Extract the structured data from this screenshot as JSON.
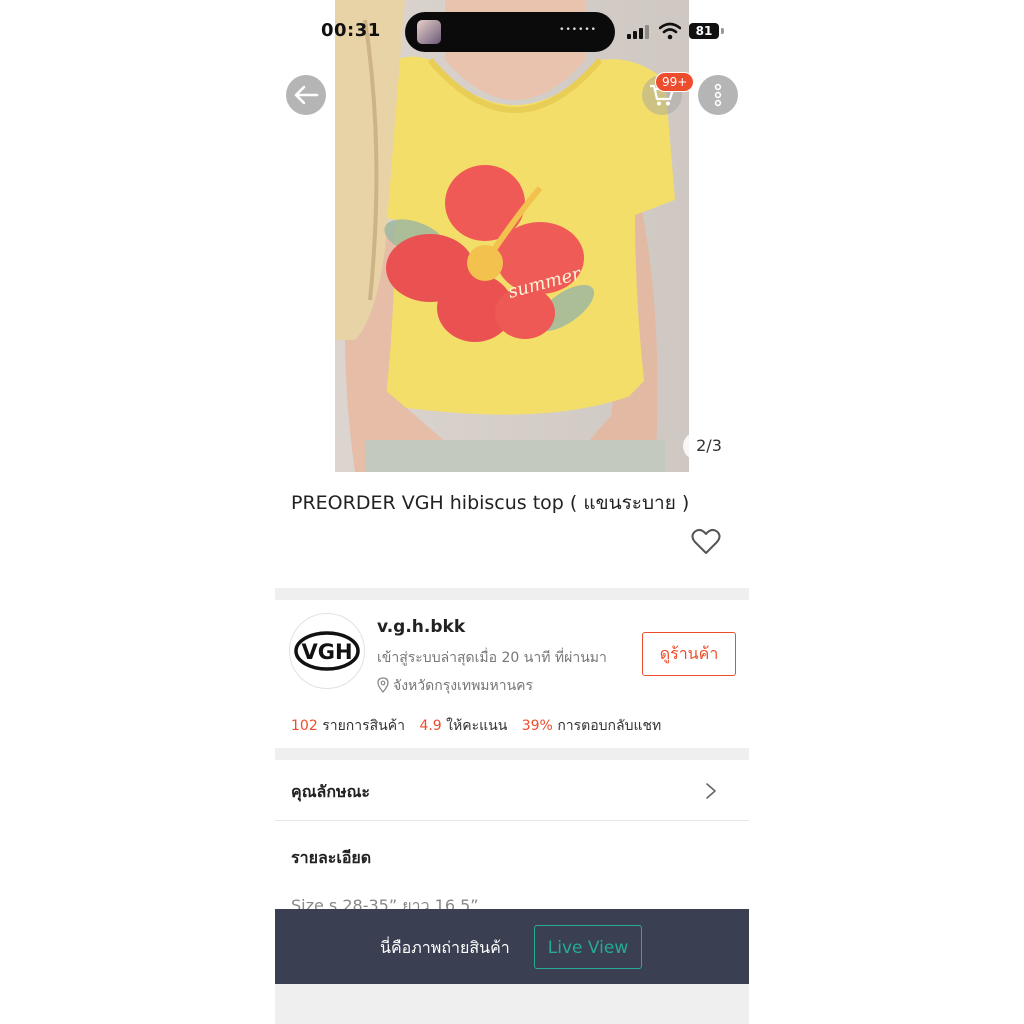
{
  "status_bar": {
    "time": "00:31",
    "battery": "81"
  },
  "header": {
    "cart_badge": "99+"
  },
  "gallery": {
    "page_indicator": "2/3",
    "shirt_print_text": "summer"
  },
  "product": {
    "title": "PREORDER  VGH hibiscus top ( แขนระบาย )"
  },
  "shop": {
    "logo_text": "VGH",
    "name": "v.g.h.bkk",
    "last_active": "เข้าสู่ระบบล่าสุดเมื่อ 20 นาที ที่ผ่านมา",
    "location": "จังหวัดกรุงเทพมหานคร",
    "view_shop_label": "ดูร้านค้า",
    "stats": [
      {
        "value": "102",
        "label": "รายการสินค้า"
      },
      {
        "value": "4.9",
        "label": "ให้คะแนน"
      },
      {
        "value": "39%",
        "label": "การตอบกลับแชท"
      }
    ]
  },
  "attributes": {
    "label": "คุณลักษณะ"
  },
  "details": {
    "title": "รายละเอียด",
    "text": "Size s 28-35” ยาว 16.5”"
  },
  "bottom_bar": {
    "text": "นี่คือภาพถ่ายสินค้า",
    "live_view_label": "Live View"
  },
  "colors": {
    "accent": "#ee4d2d",
    "live": "#26aa99",
    "bar": "#3a4052",
    "shirt": "#f4de6a"
  },
  "icons": [
    "back-arrow-icon",
    "cart-icon",
    "more-vertical-icon",
    "heart-icon",
    "location-pin-icon",
    "chevron-right-icon"
  ]
}
